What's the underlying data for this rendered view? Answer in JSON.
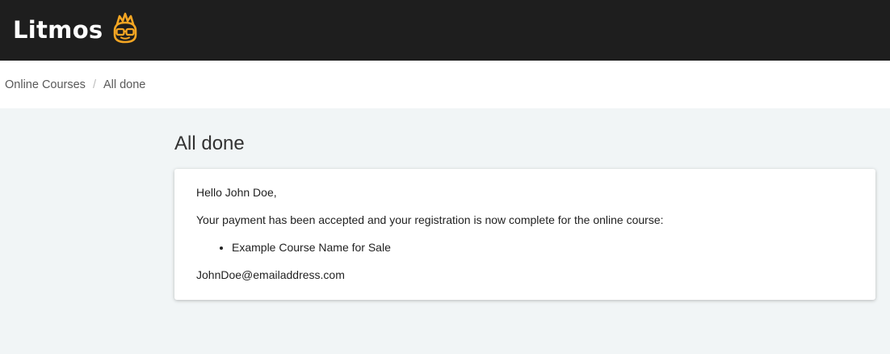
{
  "header": {
    "brand": "Litmos",
    "logo_icon": "litmos-mascot-icon",
    "logo_color": "#f5a623",
    "background": "#1e1e1e"
  },
  "breadcrumb": {
    "items": [
      "Online Courses",
      "All done"
    ],
    "separator": "/"
  },
  "main": {
    "title": "All done",
    "card": {
      "greeting": "Hello John Doe,",
      "message": "Your payment has been accepted and your registration is now complete for the online course:",
      "courses": [
        "Example Course Name for Sale"
      ],
      "email": "JohnDoe@emailaddress.com"
    }
  }
}
